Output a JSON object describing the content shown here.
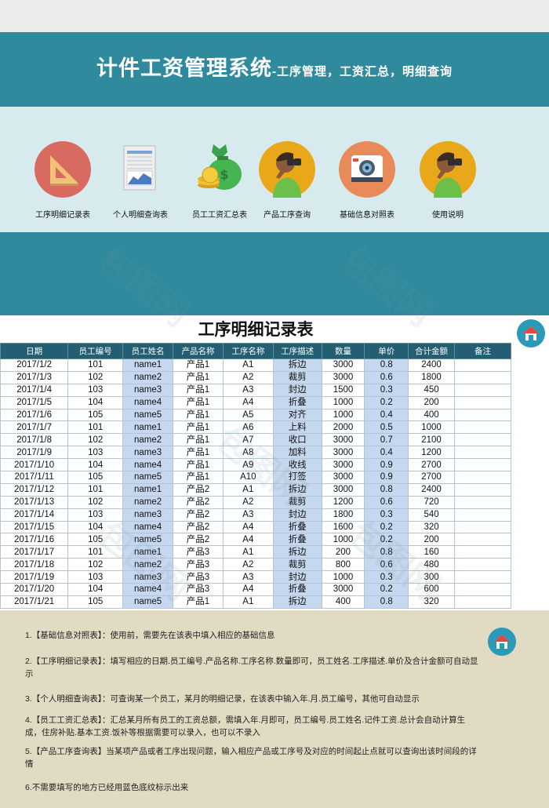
{
  "banner": {
    "title": "计件工资管理系统",
    "subtitle": "-工序管理，工资汇总，明细查询"
  },
  "nav": [
    {
      "label": "工序明细记录表",
      "icon": "ruler-triangle-icon"
    },
    {
      "label": "个人明细查询表",
      "icon": "spreadsheet-chart-icon"
    },
    {
      "label": "员工工资汇总表",
      "icon": "money-bag-icon"
    },
    {
      "label": "产品工序查询",
      "icon": "binoculars-person-icon"
    },
    {
      "label": "基础信息对照表",
      "icon": "camera-icon"
    },
    {
      "label": "使用说明",
      "icon": "binoculars-person-icon"
    }
  ],
  "sheet": {
    "title": "工序明细记录表",
    "headers": [
      "日期",
      "员工编号",
      "员工姓名",
      "产品名称",
      "工序名称",
      "工序描述",
      "数量",
      "单价",
      "合计金额",
      "备注"
    ],
    "rows": [
      [
        "2017/1/2",
        "101",
        "name1",
        "产品1",
        "A1",
        "拆边",
        "3000",
        "0.8",
        "2400",
        ""
      ],
      [
        "2017/1/3",
        "102",
        "name2",
        "产品1",
        "A2",
        "裁剪",
        "3000",
        "0.6",
        "1800",
        ""
      ],
      [
        "2017/1/4",
        "103",
        "name3",
        "产品1",
        "A3",
        "封边",
        "1500",
        "0.3",
        "450",
        ""
      ],
      [
        "2017/1/5",
        "104",
        "name4",
        "产品1",
        "A4",
        "折叠",
        "1000",
        "0.2",
        "200",
        ""
      ],
      [
        "2017/1/6",
        "105",
        "name5",
        "产品1",
        "A5",
        "对齐",
        "1000",
        "0.4",
        "400",
        ""
      ],
      [
        "2017/1/7",
        "101",
        "name1",
        "产品1",
        "A6",
        "上料",
        "2000",
        "0.5",
        "1000",
        ""
      ],
      [
        "2017/1/8",
        "102",
        "name2",
        "产品1",
        "A7",
        "收口",
        "3000",
        "0.7",
        "2100",
        ""
      ],
      [
        "2017/1/9",
        "103",
        "name3",
        "产品1",
        "A8",
        "加料",
        "3000",
        "0.4",
        "1200",
        ""
      ],
      [
        "2017/1/10",
        "104",
        "name4",
        "产品1",
        "A9",
        "收线",
        "3000",
        "0.9",
        "2700",
        ""
      ],
      [
        "2017/1/11",
        "105",
        "name5",
        "产品1",
        "A10",
        "打签",
        "3000",
        "0.9",
        "2700",
        ""
      ],
      [
        "2017/1/12",
        "101",
        "name1",
        "产品2",
        "A1",
        "拆边",
        "3000",
        "0.8",
        "2400",
        ""
      ],
      [
        "2017/1/13",
        "102",
        "name2",
        "产品2",
        "A2",
        "裁剪",
        "1200",
        "0.6",
        "720",
        ""
      ],
      [
        "2017/1/14",
        "103",
        "name3",
        "产品2",
        "A3",
        "封边",
        "1800",
        "0.3",
        "540",
        ""
      ],
      [
        "2017/1/15",
        "104",
        "name4",
        "产品2",
        "A4",
        "折叠",
        "1600",
        "0.2",
        "320",
        ""
      ],
      [
        "2017/1/16",
        "105",
        "name5",
        "产品2",
        "A4",
        "折叠",
        "1000",
        "0.2",
        "200",
        ""
      ],
      [
        "2017/1/17",
        "101",
        "name1",
        "产品3",
        "A1",
        "拆边",
        "200",
        "0.8",
        "160",
        ""
      ],
      [
        "2017/1/18",
        "102",
        "name2",
        "产品3",
        "A2",
        "裁剪",
        "800",
        "0.6",
        "480",
        ""
      ],
      [
        "2017/1/19",
        "103",
        "name3",
        "产品3",
        "A3",
        "封边",
        "1000",
        "0.3",
        "300",
        ""
      ],
      [
        "2017/1/20",
        "104",
        "name4",
        "产品3",
        "A4",
        "折叠",
        "3000",
        "0.2",
        "600",
        ""
      ],
      [
        "2017/1/21",
        "105",
        "name5",
        "产品1",
        "A1",
        "拆边",
        "400",
        "0.8",
        "320",
        ""
      ]
    ]
  },
  "notes": [
    "1.【基础信息对照表】：使用前，需要先在该表中填入相应的基础信息",
    "2.【工序明细记录表】：填写相应的日期.员工编号.产品名称.工序名称.数量即可，员工姓名.工序描述.单价及合计金额可自动显示",
    "3.【个人明细查询表】：可查询某一个员工，某月的明细记录，在该表中输入年.月.员工编号，其他可自动显示",
    "4.【员工工资汇总表】：汇总某月所有员工的工资总额，需填入年.月即可，员工编号.员工姓名.记件工资.总计会自动计算生成，住房补贴.基本工资.饭补等根据需要可以录入，也可以不录入",
    "5.【产品工序查询表】当某项产品或者工序出现问题，输入相应产品或工序号及对应的时间起止点就可以查询出该时间段的详情",
    "6.不需要填写的地方已经用蓝色底纹标示出来"
  ],
  "watermark": "包图网",
  "colors": {
    "banner": "#2e8a9c",
    "nav_bg": "#d7ebef",
    "table_header": "#235e73",
    "highlight_cell": "#c6d8ef",
    "notes_bg": "#e2dbc3",
    "home_button": "#2a9ab8"
  }
}
